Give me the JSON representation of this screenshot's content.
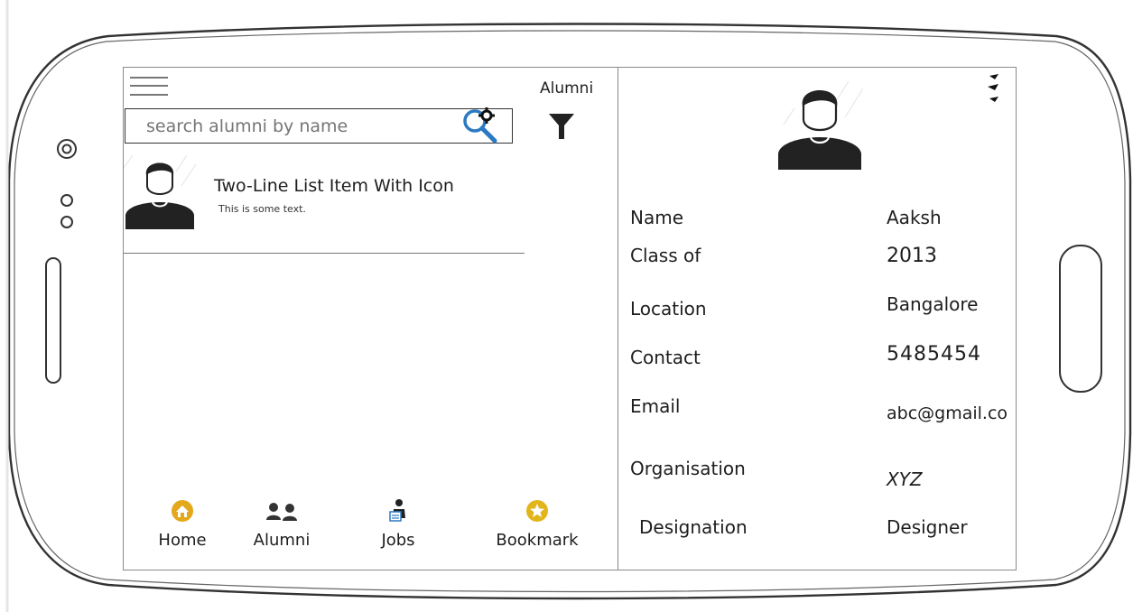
{
  "header": {
    "title": "Alumni",
    "menu_icon": "hamburger-menu-icon"
  },
  "search": {
    "placeholder": "search alumni by name",
    "value": "",
    "icon": "search-gear-icon"
  },
  "filter": {
    "icon": "funnel-icon"
  },
  "list": {
    "items": [
      {
        "title": "Two-Line List Item With Icon",
        "subtitle": "This is some text.",
        "icon": "person-avatar-icon"
      }
    ]
  },
  "bottom_nav": {
    "items": [
      {
        "label": "Home",
        "icon": "home-icon",
        "color": "#e3a81c"
      },
      {
        "label": "Alumni",
        "icon": "people-icon"
      },
      {
        "label": "Jobs",
        "icon": "jobs-icon"
      },
      {
        "label": "Bookmark",
        "icon": "star-icon",
        "color": "#e3b51c"
      }
    ]
  },
  "profile": {
    "avatar_icon": "person-avatar-icon",
    "more_icon": "more-options-icon",
    "fields": [
      {
        "label": "Name",
        "value": "Aaksh"
      },
      {
        "label": "Class of",
        "value": "2013"
      },
      {
        "label": "Location",
        "value": "Bangalore"
      },
      {
        "label": "Contact",
        "value": "5485454"
      },
      {
        "label": "Email",
        "value": "abc@gmail.co"
      },
      {
        "label": "Organisation",
        "value": "XYZ"
      },
      {
        "label": "Designation",
        "value": "Designer"
      }
    ]
  }
}
